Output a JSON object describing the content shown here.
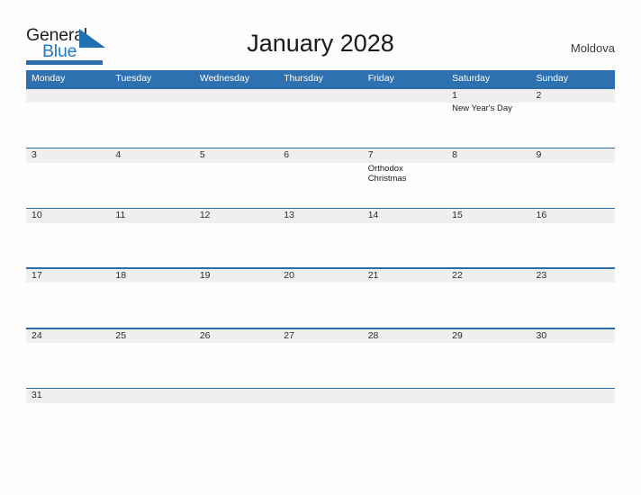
{
  "brand": {
    "name_part1": "General",
    "name_part2": "Blue",
    "flag_icon": "blue-triangle-flag-icon",
    "accent_color": "#2b6da8",
    "blue_text_color": "#1f7bc4"
  },
  "header": {
    "title": "January 2028",
    "country": "Moldova"
  },
  "calendar": {
    "month": "January",
    "year": "2028",
    "header_bg_color": "#2e71b0",
    "number_band_color": "#efefef",
    "weekday_headers": [
      "Monday",
      "Tuesday",
      "Wednesday",
      "Thursday",
      "Friday",
      "Saturday",
      "Sunday"
    ],
    "weeks": [
      {
        "days": [
          {
            "number": "",
            "events": []
          },
          {
            "number": "",
            "events": []
          },
          {
            "number": "",
            "events": []
          },
          {
            "number": "",
            "events": []
          },
          {
            "number": "",
            "events": []
          },
          {
            "number": "1",
            "events": [
              "New Year's Day"
            ]
          },
          {
            "number": "2",
            "events": []
          }
        ]
      },
      {
        "days": [
          {
            "number": "3",
            "events": []
          },
          {
            "number": "4",
            "events": []
          },
          {
            "number": "5",
            "events": []
          },
          {
            "number": "6",
            "events": []
          },
          {
            "number": "7",
            "events": [
              "Orthodox Christmas"
            ]
          },
          {
            "number": "8",
            "events": []
          },
          {
            "number": "9",
            "events": []
          }
        ]
      },
      {
        "days": [
          {
            "number": "10",
            "events": []
          },
          {
            "number": "11",
            "events": []
          },
          {
            "number": "12",
            "events": []
          },
          {
            "number": "13",
            "events": []
          },
          {
            "number": "14",
            "events": []
          },
          {
            "number": "15",
            "events": []
          },
          {
            "number": "16",
            "events": []
          }
        ]
      },
      {
        "days": [
          {
            "number": "17",
            "events": []
          },
          {
            "number": "18",
            "events": []
          },
          {
            "number": "19",
            "events": []
          },
          {
            "number": "20",
            "events": []
          },
          {
            "number": "21",
            "events": []
          },
          {
            "number": "22",
            "events": []
          },
          {
            "number": "23",
            "events": []
          }
        ]
      },
      {
        "days": [
          {
            "number": "24",
            "events": []
          },
          {
            "number": "25",
            "events": []
          },
          {
            "number": "26",
            "events": []
          },
          {
            "number": "27",
            "events": []
          },
          {
            "number": "28",
            "events": []
          },
          {
            "number": "29",
            "events": []
          },
          {
            "number": "30",
            "events": []
          }
        ]
      },
      {
        "days": [
          {
            "number": "31",
            "events": []
          },
          {
            "number": "",
            "events": []
          },
          {
            "number": "",
            "events": []
          },
          {
            "number": "",
            "events": []
          },
          {
            "number": "",
            "events": []
          },
          {
            "number": "",
            "events": []
          },
          {
            "number": "",
            "events": []
          }
        ]
      }
    ]
  }
}
